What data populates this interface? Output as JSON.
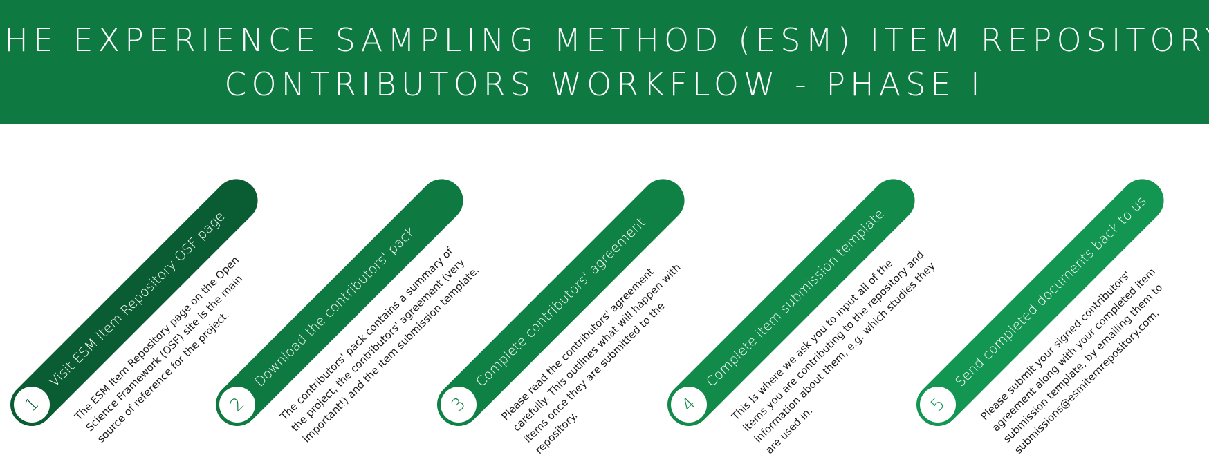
{
  "header": {
    "title_line1": "THE EXPERIENCE SAMPLING METHOD (ESM) ITEM REPOSITORY",
    "title_line2": "CONTRIBUTORS WORKFLOW - PHASE I",
    "background_color": "#0e7a42"
  },
  "steps": [
    {
      "number": "1",
      "label": "Visit ESM Item Repository OSF page",
      "description": "The ESM Item Repository page on the Open\nScience Framework (OSF) site is the main\nsource of reference for the project.",
      "color": "#0a5c33"
    },
    {
      "number": "2",
      "label": "Download the contributors' pack",
      "description": "The contributors' pack contains a summary of\nthe project, the contributors' agreement (very\nimportant!) and the item submission template.",
      "color": "#0e7a42"
    },
    {
      "number": "3",
      "label": "Complete contributors' agreement",
      "description": "Please read the contributors' agreement\ncarefully. This outlines what will happen with\nitems once they are submitted to the\nrepository.",
      "color": "#0f8145"
    },
    {
      "number": "4",
      "label": "Complete item submission template",
      "description": "This is where we ask you to input all of the\nitems you are contributing to the repository and\ninformation about them, e.g. which studies they\nare used in.",
      "color": "#118a4a"
    },
    {
      "number": "5",
      "label": "Send completed documents back to us",
      "description": "Please submit your signed contributors'\nagreement along with your completed item\nsubmission template, by emailing them to\nsubmissions@esmitemrepository.com.",
      "color": "#139652"
    }
  ]
}
